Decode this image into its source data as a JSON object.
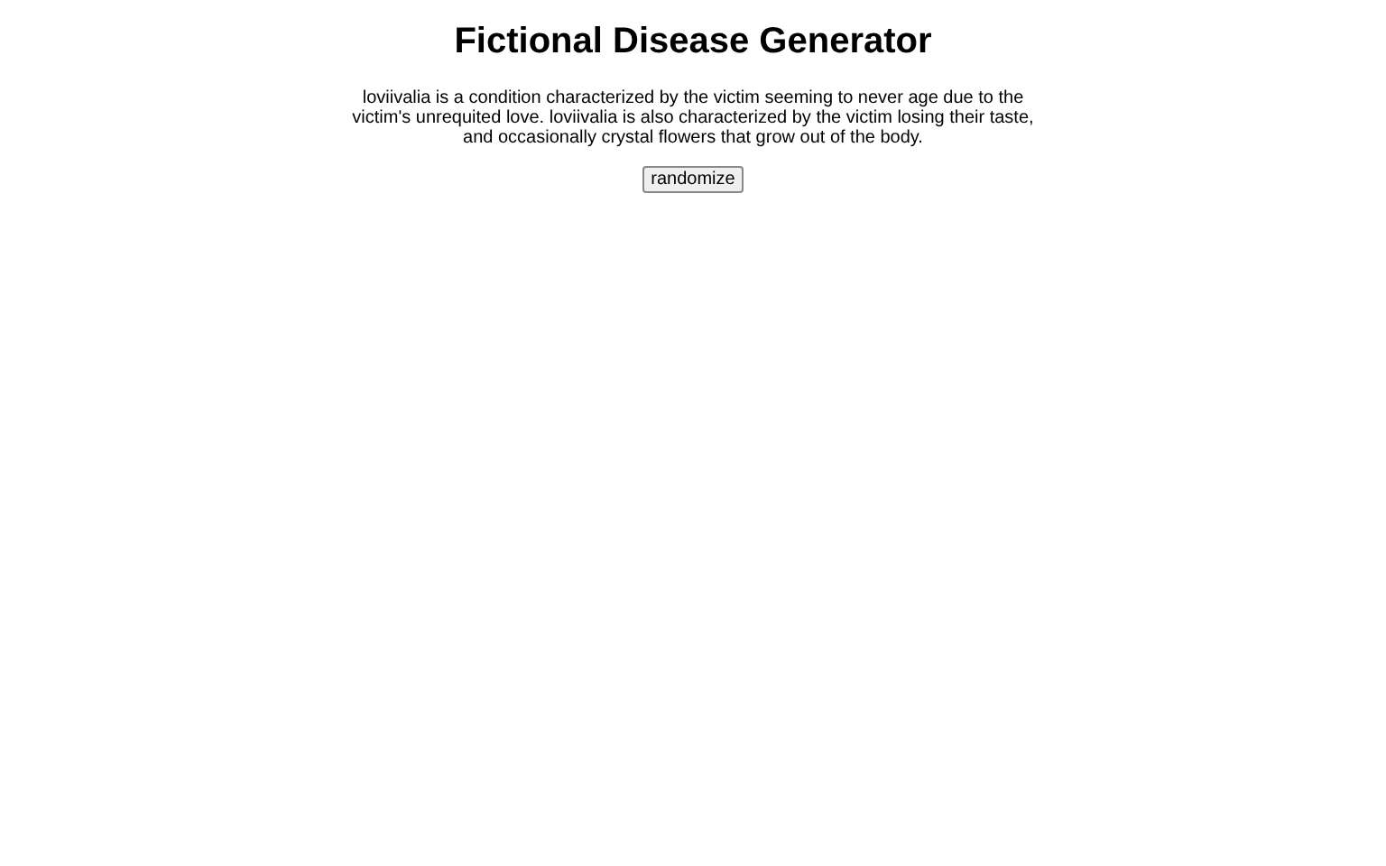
{
  "title": "Fictional Disease Generator",
  "description": "loviivalia is a condition characterized by the victim seeming to never age due to the victim's unrequited love. loviivalia is also characterized by the victim losing their taste, and occasionally crystal flowers that grow out of the body.",
  "button": "randomize"
}
